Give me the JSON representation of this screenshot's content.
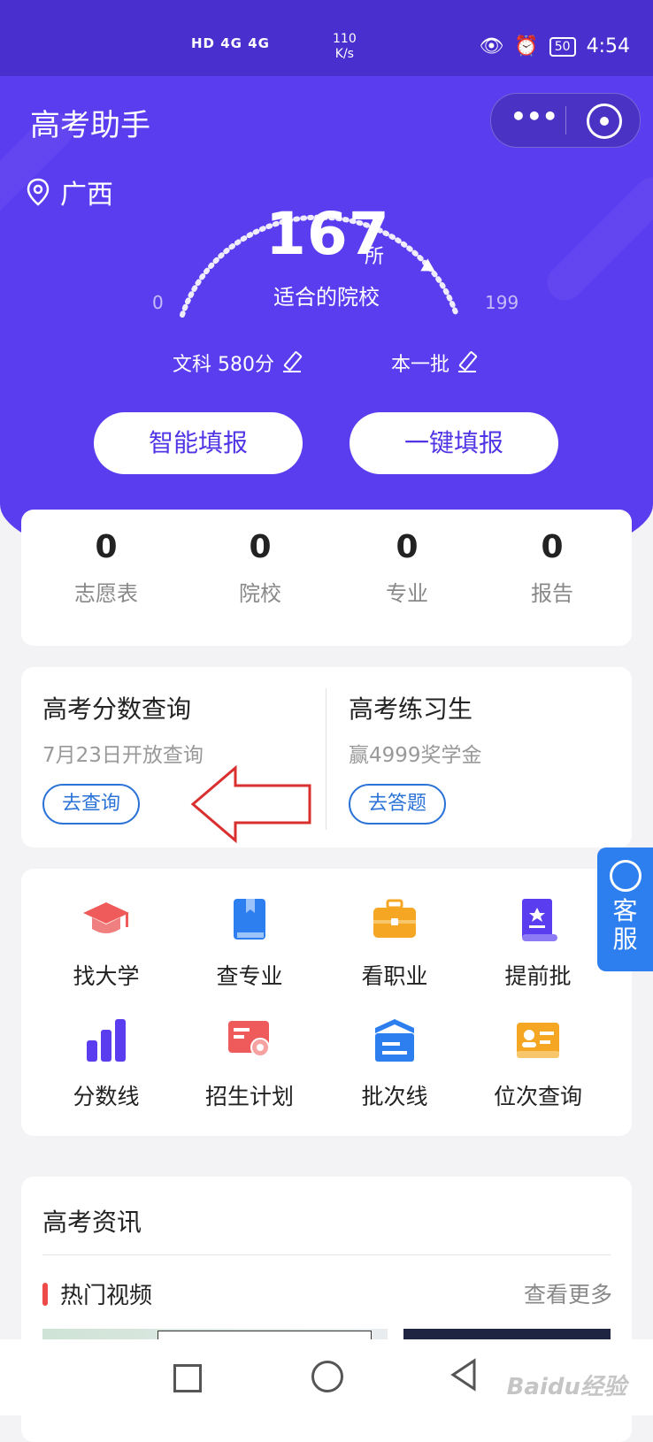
{
  "status_bar": {
    "network": "HD 4G 4G",
    "speed_value": "110",
    "speed_unit": "K/s",
    "battery": "50",
    "time": "4:54"
  },
  "app": {
    "title": "高考助手"
  },
  "location": {
    "name": "广西"
  },
  "gauge": {
    "count": "167",
    "unit": "所",
    "label": "适合的院校",
    "min": "0",
    "max": "199",
    "level": 0.84
  },
  "score": {
    "subject_label": "文科 580分",
    "batch_label": "本一批"
  },
  "actions": {
    "smart_fill": "智能填报",
    "one_click_fill": "一键填报"
  },
  "stats": [
    {
      "value": "0",
      "label": "志愿表"
    },
    {
      "value": "0",
      "label": "院校"
    },
    {
      "value": "0",
      "label": "专业"
    },
    {
      "value": "0",
      "label": "报告"
    }
  ],
  "promo": {
    "left": {
      "title": "高考分数查询",
      "subtitle": "7月23日开放查询",
      "button": "去查询"
    },
    "right": {
      "title": "高考练习生",
      "subtitle": "赢4999奖学金",
      "button": "去答题"
    }
  },
  "grid": [
    {
      "label": "找大学",
      "icon": "graduation-cap-icon",
      "color": "#ef5b5b"
    },
    {
      "label": "查专业",
      "icon": "book-icon",
      "color": "#2d7ff0"
    },
    {
      "label": "看职业",
      "icon": "briefcase-icon",
      "color": "#f5a623"
    },
    {
      "label": "提前批",
      "icon": "scroll-icon",
      "color": "#5b3df0"
    },
    {
      "label": "分数线",
      "icon": "bar-chart-icon",
      "color": "#5b3df0"
    },
    {
      "label": "招生计划",
      "icon": "certificate-icon",
      "color": "#ef5b5b"
    },
    {
      "label": "批次线",
      "icon": "stack-icon",
      "color": "#2d7ff0"
    },
    {
      "label": "位次查询",
      "icon": "id-card-icon",
      "color": "#f5a623"
    }
  ],
  "customer_service": {
    "label_line1": "客",
    "label_line2": "服"
  },
  "news": {
    "heading": "高考资讯",
    "section": "热门视频",
    "more": "查看更多"
  },
  "watermark": "Baidu经验",
  "colors": {
    "primary": "#5b3df0",
    "accent_blue": "#2d7ff0",
    "red": "#ef4a4a"
  }
}
